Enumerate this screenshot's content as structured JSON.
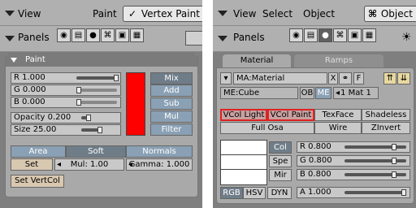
{
  "left": {
    "header": {
      "view": "View",
      "paint": "Paint",
      "mode": "Vertex Paint"
    },
    "panels_label": "Panels",
    "paint_panel": {
      "title": "Paint",
      "r": "R 1.000",
      "g": "G 0.000",
      "b": "B 0.000",
      "opacity": "Opacity 0.200",
      "size": "Size 25.00",
      "color_swatch": "#ff0000",
      "blend_buttons": [
        "Mix",
        "Add",
        "Sub",
        "Mul",
        "Filter"
      ],
      "area": "Area",
      "soft": "Soft",
      "normals": "Normals",
      "set": "Set",
      "mul": "Mul: 1.00",
      "gamma": "Gamma: 1.000",
      "set_vertcol": "Set VertCol"
    }
  },
  "right": {
    "header": {
      "view": "View",
      "select": "Select",
      "object": "Object",
      "mode": "Object"
    },
    "panels_label": "Panels",
    "tabs": {
      "material": "Material",
      "ramps": "Ramps"
    },
    "material": {
      "ma_name": "MA:Material",
      "x": "X",
      "f": "F",
      "me_name": "ME:Cube",
      "ob": "OB",
      "me": "ME",
      "mat_count": "1 Mat 1",
      "row1": [
        "VCol Light",
        "VCol Paint",
        "TexFace",
        "Shadeless"
      ],
      "row2": [
        "Full Osa",
        "Wire",
        "ZInvert"
      ],
      "col_tabs": [
        "Col",
        "Spe",
        "Mir"
      ],
      "r": "R 0.800",
      "g": "G 0.800",
      "b": "B 0.800",
      "modes": [
        "RGB",
        "HSV",
        "DYN"
      ],
      "a": "A 1.000"
    }
  },
  "colors": {
    "accent": "#ff0000",
    "header": "#b0b0b0",
    "panel": "#a9a9a9"
  }
}
